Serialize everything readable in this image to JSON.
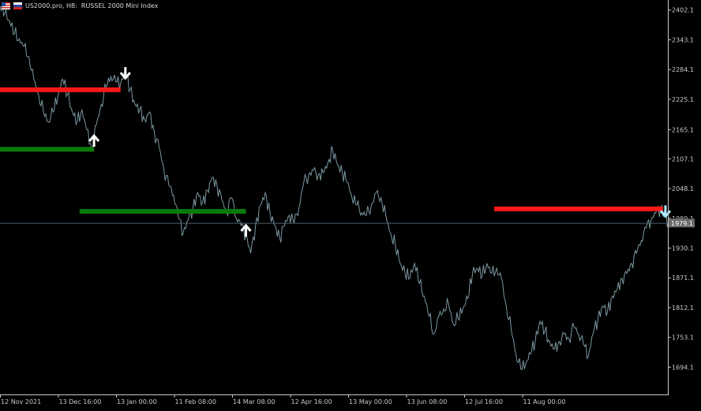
{
  "header": {
    "symbol_line": "US2000.pro, H8:  RUSSEL 2000 Mini Index",
    "flag_icons": [
      "us-flag-icon",
      "ru-flag-icon"
    ]
  },
  "colors": {
    "background": "#000000",
    "price_line": "#7a96a0",
    "axis": "#c8c8c8",
    "resistance": "#ff1a1a",
    "support": "#0a7a0a",
    "arrow_up": "#ffffff",
    "arrow_down": "#ffffff",
    "arrow_down_alt": "#aee6ff",
    "current_price_line": "#4c6070",
    "label_bg": "#6a6a6a"
  },
  "chart_data": {
    "type": "line",
    "symbol": "US2000.pro",
    "timeframe": "H8",
    "description": "RUSSEL 2000 Mini Index",
    "y_ticks": [
      2402.1,
      2343.1,
      2284.1,
      2225.1,
      2165.1,
      2107.1,
      2048.1,
      1989.1,
      1930.1,
      1871.1,
      1812.1,
      1753.1,
      1694.1
    ],
    "x_ticks": [
      "12 Nov 2021",
      "13 Dec 16:00",
      "13 Jan 00:00",
      "11 Feb 08:00",
      "14 Mar 08:00",
      "12 Apr 16:00",
      "13 May 00:00",
      "13 Jun 08:00",
      "12 Jul 16:00",
      "11 Aug 00:00"
    ],
    "x_range": [
      "2021-11-12",
      "2022-08-16"
    ],
    "ylim": [
      1640,
      2422
    ],
    "current_price": 1979.1,
    "current_price_label": "1979.1",
    "series": [
      {
        "values": [
          [
            "2021-11-12",
            2410
          ],
          [
            "2021-11-14",
            2395
          ],
          [
            "2021-11-16",
            2380
          ],
          [
            "2021-11-18",
            2355
          ],
          [
            "2021-11-20",
            2345
          ],
          [
            "2021-11-22",
            2330
          ],
          [
            "2021-11-24",
            2310
          ],
          [
            "2021-11-26",
            2265
          ],
          [
            "2021-11-28",
            2235
          ],
          [
            "2021-11-30",
            2200
          ],
          [
            "2021-12-02",
            2180
          ],
          [
            "2021-12-04",
            2200
          ],
          [
            "2021-12-06",
            2230
          ],
          [
            "2021-12-08",
            2265
          ],
          [
            "2021-12-10",
            2235
          ],
          [
            "2021-12-12",
            2200
          ],
          [
            "2021-12-14",
            2180
          ],
          [
            "2021-12-16",
            2205
          ],
          [
            "2021-12-18",
            2165
          ],
          [
            "2021-12-20",
            2130
          ],
          [
            "2021-12-22",
            2175
          ],
          [
            "2021-12-24",
            2215
          ],
          [
            "2021-12-26",
            2250
          ],
          [
            "2021-12-28",
            2270
          ],
          [
            "2021-12-30",
            2260
          ],
          [
            "2022-01-01",
            2255
          ],
          [
            "2022-01-03",
            2280
          ],
          [
            "2022-01-05",
            2245
          ],
          [
            "2022-01-07",
            2215
          ],
          [
            "2022-01-09",
            2205
          ],
          [
            "2022-01-11",
            2185
          ],
          [
            "2022-01-13",
            2200
          ],
          [
            "2022-01-15",
            2160
          ],
          [
            "2022-01-17",
            2130
          ],
          [
            "2022-01-19",
            2085
          ],
          [
            "2022-01-21",
            2055
          ],
          [
            "2022-01-23",
            2035
          ],
          [
            "2022-01-25",
            1990
          ],
          [
            "2022-01-27",
            1960
          ],
          [
            "2022-01-29",
            1985
          ],
          [
            "2022-01-31",
            2010
          ],
          [
            "2022-02-02",
            2040
          ],
          [
            "2022-02-04",
            2020
          ],
          [
            "2022-02-06",
            2045
          ],
          [
            "2022-02-08",
            2070
          ],
          [
            "2022-02-10",
            2055
          ],
          [
            "2022-02-12",
            2025
          ],
          [
            "2022-02-14",
            2000
          ],
          [
            "2022-02-16",
            2030
          ],
          [
            "2022-02-18",
            1990
          ],
          [
            "2022-02-20",
            1975
          ],
          [
            "2022-02-22",
            1955
          ],
          [
            "2022-02-24",
            1920
          ],
          [
            "2022-02-26",
            1975
          ],
          [
            "2022-02-28",
            2015
          ],
          [
            "2022-03-02",
            2040
          ],
          [
            "2022-03-04",
            2000
          ],
          [
            "2022-03-06",
            1975
          ],
          [
            "2022-03-08",
            1950
          ],
          [
            "2022-03-10",
            1975
          ],
          [
            "2022-03-12",
            1995
          ],
          [
            "2022-03-14",
            1980
          ],
          [
            "2022-03-16",
            2010
          ],
          [
            "2022-03-18",
            2060
          ],
          [
            "2022-03-20",
            2075
          ],
          [
            "2022-03-22",
            2085
          ],
          [
            "2022-03-24",
            2075
          ],
          [
            "2022-03-26",
            2080
          ],
          [
            "2022-03-28",
            2100
          ],
          [
            "2022-03-30",
            2125
          ],
          [
            "2022-04-01",
            2095
          ],
          [
            "2022-04-03",
            2080
          ],
          [
            "2022-04-05",
            2060
          ],
          [
            "2022-04-07",
            2030
          ],
          [
            "2022-04-09",
            2015
          ],
          [
            "2022-04-11",
            2000
          ],
          [
            "2022-04-13",
            1995
          ],
          [
            "2022-04-15",
            2015
          ],
          [
            "2022-04-17",
            2040
          ],
          [
            "2022-04-19",
            2030
          ],
          [
            "2022-04-21",
            1995
          ],
          [
            "2022-04-23",
            1960
          ],
          [
            "2022-04-25",
            1935
          ],
          [
            "2022-04-27",
            1900
          ],
          [
            "2022-04-29",
            1880
          ],
          [
            "2022-05-01",
            1870
          ],
          [
            "2022-05-03",
            1900
          ],
          [
            "2022-05-05",
            1860
          ],
          [
            "2022-05-07",
            1835
          ],
          [
            "2022-05-09",
            1795
          ],
          [
            "2022-05-11",
            1760
          ],
          [
            "2022-05-13",
            1795
          ],
          [
            "2022-05-15",
            1810
          ],
          [
            "2022-05-17",
            1820
          ],
          [
            "2022-05-19",
            1780
          ],
          [
            "2022-05-21",
            1790
          ],
          [
            "2022-05-23",
            1810
          ],
          [
            "2022-05-25",
            1830
          ],
          [
            "2022-05-27",
            1880
          ],
          [
            "2022-05-29",
            1890
          ],
          [
            "2022-05-31",
            1875
          ],
          [
            "2022-06-02",
            1900
          ],
          [
            "2022-06-04",
            1880
          ],
          [
            "2022-06-06",
            1890
          ],
          [
            "2022-06-08",
            1870
          ],
          [
            "2022-06-10",
            1815
          ],
          [
            "2022-06-12",
            1770
          ],
          [
            "2022-06-14",
            1720
          ],
          [
            "2022-06-16",
            1690
          ],
          [
            "2022-06-18",
            1700
          ],
          [
            "2022-06-20",
            1720
          ],
          [
            "2022-06-22",
            1745
          ],
          [
            "2022-06-24",
            1785
          ],
          [
            "2022-06-26",
            1765
          ],
          [
            "2022-06-28",
            1745
          ],
          [
            "2022-06-30",
            1730
          ],
          [
            "2022-07-02",
            1745
          ],
          [
            "2022-07-04",
            1760
          ],
          [
            "2022-07-06",
            1750
          ],
          [
            "2022-07-08",
            1775
          ],
          [
            "2022-07-10",
            1760
          ],
          [
            "2022-07-12",
            1740
          ],
          [
            "2022-07-14",
            1715
          ],
          [
            "2022-07-16",
            1760
          ],
          [
            "2022-07-18",
            1790
          ],
          [
            "2022-07-20",
            1815
          ],
          [
            "2022-07-22",
            1805
          ],
          [
            "2022-07-24",
            1835
          ],
          [
            "2022-07-26",
            1850
          ],
          [
            "2022-07-28",
            1870
          ],
          [
            "2022-07-30",
            1880
          ],
          [
            "2022-08-01",
            1900
          ],
          [
            "2022-08-03",
            1920
          ],
          [
            "2022-08-05",
            1945
          ],
          [
            "2022-08-07",
            1970
          ],
          [
            "2022-08-09",
            1985
          ],
          [
            "2022-08-11",
            2000
          ],
          [
            "2022-08-13",
            2010
          ],
          [
            "2022-08-15",
            1995
          ],
          [
            "2022-08-16",
            1979.1
          ]
        ]
      }
    ],
    "levels": [
      {
        "kind": "resistance",
        "price": 2244,
        "from": "2021-11-12",
        "to": "2022-01-01"
      },
      {
        "kind": "support",
        "price": 2126,
        "from": "2021-11-12",
        "to": "2021-12-21"
      },
      {
        "kind": "support",
        "price": 2003,
        "from": "2021-12-15",
        "to": "2022-02-22"
      },
      {
        "kind": "resistance",
        "price": 2008,
        "from": "2022-06-05",
        "to": "2022-08-14"
      }
    ],
    "arrows": [
      {
        "direction": "down",
        "date": "2022-01-03",
        "price": 2278,
        "color": "#ffffff"
      },
      {
        "direction": "up",
        "date": "2021-12-21",
        "price": 2142,
        "color": "#ffffff"
      },
      {
        "direction": "up",
        "date": "2022-02-22",
        "price": 1964,
        "color": "#ffffff"
      },
      {
        "direction": "down",
        "date": "2022-08-15",
        "price": 2004,
        "color": "#aee6ff"
      }
    ]
  }
}
